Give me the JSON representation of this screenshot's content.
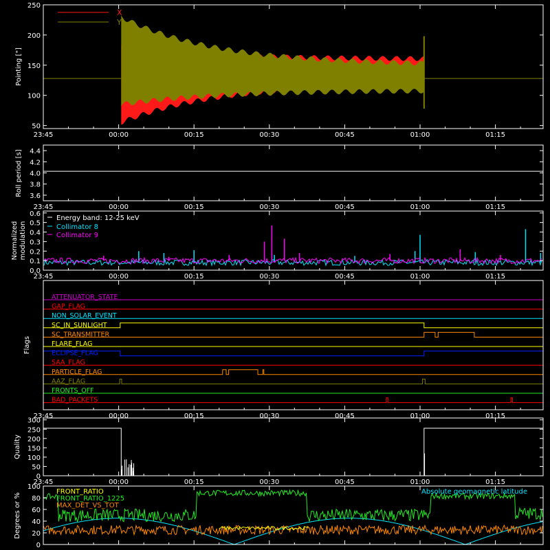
{
  "colors": {
    "background": "#000000",
    "axes": "#ffffff",
    "x_red": "#ff1a1a",
    "y_olive": "#808000",
    "cyan": "#00e5ff",
    "magenta": "#ff00ff",
    "yellow": "#ffff00",
    "orange": "#ff8800",
    "green": "#22ee22",
    "blue": "#0022ff",
    "red": "#ff0000",
    "purple": "#cc00cc",
    "pink": "#ff2255"
  },
  "time_ticks": [
    "23:45",
    "00:00",
    "00:15",
    "00:30",
    "00:45",
    "01:00",
    "01:15"
  ],
  "chart_data": [
    {
      "type": "line",
      "panel": "pointing",
      "ylabel": "Pointing [\"]",
      "ylim": [
        45,
        250
      ],
      "yticks": [
        "250",
        "200",
        "150",
        "100",
        "50"
      ],
      "yticks_values": [
        250,
        200,
        150,
        100,
        50
      ],
      "legend": [
        "X",
        "Y"
      ],
      "legend_placement": "top-left",
      "baseline": 128,
      "active_window_minutes": [
        0.5,
        60.8
      ],
      "series": [
        {
          "name": "X",
          "color_key": "x_red",
          "start_range": [
            55,
            180
          ],
          "end_range": [
            120,
            160
          ]
        },
        {
          "name": "Y",
          "color_key": "y_olive",
          "start_range": [
            85,
            230
          ],
          "end_range": [
            108,
            150
          ]
        }
      ]
    },
    {
      "type": "line",
      "panel": "roll",
      "ylabel": "Roll period [s]",
      "ylim": [
        3.5,
        4.5
      ],
      "yticks": [
        "4.4",
        "4.2",
        "4.0",
        "3.8",
        "3.6"
      ],
      "yticks_values": [
        4.4,
        4.2,
        4.0,
        3.8,
        3.6
      ],
      "value": 4.03
    },
    {
      "type": "line",
      "panel": "modulation",
      "ylabel_lines": [
        "Normalized",
        "modulation"
      ],
      "ylim": [
        0,
        0.62
      ],
      "yticks": [
        "0.6",
        "0.5",
        "0.4",
        "0.3",
        "0.2",
        "0.1",
        "0.0"
      ],
      "yticks_values": [
        0.6,
        0.5,
        0.4,
        0.3,
        0.2,
        0.1,
        0.0
      ],
      "legend_title": "Energy band: 12-25 keV",
      "legend": [
        "Collimator 8",
        "Collimator 9"
      ],
      "series": [
        {
          "name": "Collimator 8",
          "color_key": "cyan",
          "baseline": 0.08,
          "spikes": [
            [
              4,
              0.2
            ],
            [
              9,
              0.18
            ],
            [
              15,
              0.21
            ],
            [
              31,
              0.16
            ],
            [
              47,
              0.15
            ],
            [
              59,
              0.2
            ],
            [
              60,
              0.37
            ],
            [
              71,
              0.19
            ],
            [
              81,
              0.43
            ],
            [
              84,
              0.18
            ]
          ]
        },
        {
          "name": "Collimator 9",
          "color_key": "magenta",
          "baseline": 0.1,
          "spikes": [
            [
              -3,
              0.15
            ],
            [
              10,
              0.14
            ],
            [
              22,
              0.16
            ],
            [
              29,
              0.3
            ],
            [
              30.5,
              0.47
            ],
            [
              33,
              0.33
            ],
            [
              36,
              0.18
            ],
            [
              54,
              0.17
            ],
            [
              68,
              0.22
            ],
            [
              76,
              0.16
            ]
          ]
        }
      ]
    },
    {
      "type": "table",
      "panel": "flags",
      "ylabel": "Flags",
      "rows": [
        {
          "label": "ATTENUATOR_STATE",
          "color_key": "purple",
          "segments": []
        },
        {
          "label": "GAP_FLAG",
          "color_key": "red",
          "segments": []
        },
        {
          "label": "NON_SOLAR_EVENT",
          "color_key": "cyan",
          "segments": []
        },
        {
          "label": "SC_IN_SUNLIGHT",
          "color_key": "yellow",
          "segments": [
            [
              0.3,
              60.8
            ]
          ]
        },
        {
          "label": "SC_TRANSMITTER",
          "color_key": "orange",
          "segments": [
            [
              60.8,
              63.0
            ],
            [
              63.6,
              70.8
            ]
          ]
        },
        {
          "label": "FLARE_FLAG",
          "color_key": "yellow",
          "segments": []
        },
        {
          "label": "ECLIPSE_FLAG",
          "color_key": "blue",
          "segments": [
            [
              -15,
              0.3
            ],
            [
              60.8,
              84.5
            ]
          ]
        },
        {
          "label": "SAA_FLAG",
          "color_key": "red",
          "segments": []
        },
        {
          "label": "PARTICLE_FLAG",
          "color_key": "orange",
          "segments": [
            [
              20.7,
              21.4
            ],
            [
              21.9,
              27.7
            ],
            [
              28.7,
              28.9
            ]
          ]
        },
        {
          "label": "AAZ_FLAG",
          "color_key": "y_olive",
          "segments": [
            [
              0.2,
              0.6
            ],
            [
              60.5,
              61.0
            ]
          ]
        },
        {
          "label": "FRONTS_OFF",
          "color_key": "green",
          "segments": []
        },
        {
          "label": "BAD_PACKETS",
          "color_key": "red",
          "segments": [
            [
              53.3,
              53.6
            ],
            [
              78.1,
              78.4
            ]
          ]
        }
      ]
    },
    {
      "type": "line",
      "panel": "quality",
      "ylabel": "Quality",
      "ylim": [
        0,
        310
      ],
      "yticks": [
        "300",
        "250",
        "200",
        "150",
        "100",
        "50",
        "0"
      ],
      "yticks_values": [
        300,
        250,
        200,
        150,
        100,
        50,
        0
      ],
      "segments": [
        {
          "x": [
            -15,
            0.5
          ],
          "value": 255
        },
        {
          "x": [
            0.5,
            60.8
          ],
          "value": 0
        },
        {
          "x": [
            60.8,
            84.5
          ],
          "value": 255
        }
      ]
    },
    {
      "type": "line",
      "panel": "ratios",
      "ylabel": "Degrees or %",
      "ylim": [
        0,
        100
      ],
      "yticks": [
        "100",
        "80",
        "60",
        "40",
        "20",
        "0"
      ],
      "yticks_values": [
        100,
        80,
        60,
        40,
        20,
        0
      ],
      "legend": [
        "FRONT_RATIO",
        "FRONT_RATIO_1225",
        "MAX_DET_VS_TOT"
      ],
      "legend_placement": "top-left",
      "annotation": "Absolute geomagnetic latitude",
      "series": [
        {
          "name": "FRONT_RATIO_1225",
          "color_key": "green",
          "levels": [
            [
              -15,
              82
            ],
            [
              -12,
              50
            ],
            [
              15.5,
              88
            ],
            [
              37.5,
              50
            ],
            [
              62,
              83
            ],
            [
              79,
              53
            ]
          ]
        },
        {
          "name": "MAX_DET_VS_TOT",
          "color_key": "orange",
          "level": 25
        },
        {
          "name": "FRONT_RATIO",
          "color_key": "yellow",
          "level": 28,
          "visible_from": 20,
          "visible_to": 38
        },
        {
          "name": "Absolute geomagnetic latitude",
          "color_key": "cyan",
          "amplitude": 45,
          "period_minutes": 46,
          "phase": 0.5
        }
      ]
    }
  ]
}
